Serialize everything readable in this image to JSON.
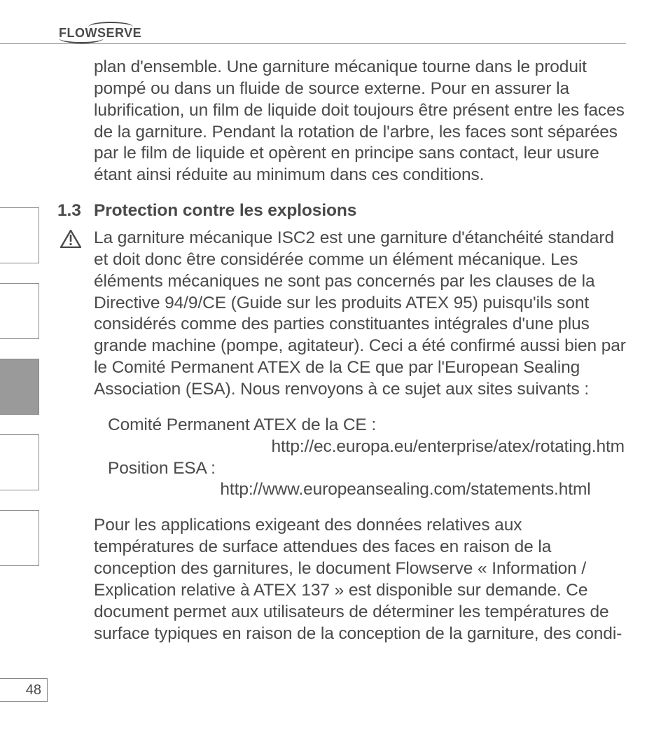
{
  "header": {
    "logo_text": "FLOWSERVE"
  },
  "body": {
    "intro_para": "plan d'ensemble. Une garniture mécanique tourne dans le produit pompé ou dans un fluide de source externe. Pour en assurer la lubrification, un film de liquide doit toujours être présent entre les faces de la garniture. Pendant la rotation de l'arbre, les faces sont séparées par le film de liquide  et opèrent en principe sans contact, leur usure étant ainsi réduite au minimum dans ces conditions.",
    "section": {
      "number": "1.3",
      "title": "Protection contre les explosions",
      "p1": "La garniture mécanique ISC2 est une garniture d'étanchéité standard et doit donc être considérée comme un élément mécanique. Les éléments mécaniques ne sont pas concernés par les clauses de la Directive 94/9/CE (Guide sur les produits ATEX 95) puisqu'ils sont considérés comme des parties constituantes intégrales d'une plus grande machine (pompe, agitateur). Ceci a été confirmé aussi bien par le Comité Permanent ATEX de la CE que par l'European Sealing Association (ESA). Nous renvoyons à ce sujet aux sites suivants :",
      "ref_label_1": "Comité Permanent ATEX de la CE :",
      "ref_url_1": "http://ec.europa.eu/enterprise/atex/rotating.htm",
      "ref_label_2": "Position ESA :",
      "ref_url_2": "http://www.europeansealing.com/statements.html",
      "p2": "Pour les applications exigeant des données relatives aux températures de surface attendues des faces en raison de la conception des garnitures, le document Flowserve « Information / Explication relative à ATEX 137 » est disponible sur demande. Ce document permet aux utilisateurs de déterminer les températures de surface typiques en raison de la conception de la garniture, des condi-"
    }
  },
  "tabs": {
    "active_index": 2,
    "count": 5
  },
  "page_number": "48",
  "icons": {
    "warning": "warning-triangle-icon"
  }
}
